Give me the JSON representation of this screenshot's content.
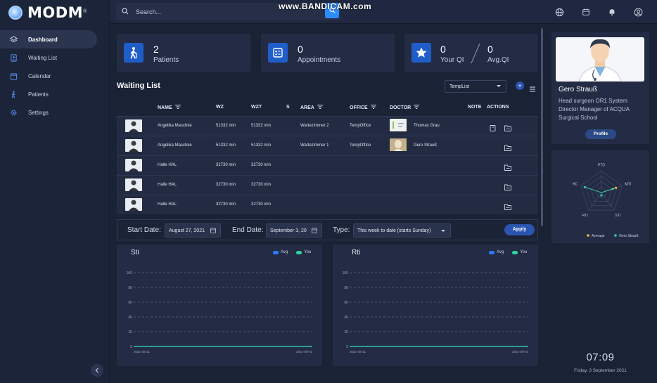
{
  "app": {
    "name": "MODM",
    "trademark": "®"
  },
  "watermark": "www.BANDICAM.com",
  "search": {
    "placeholder": "Search..."
  },
  "sidebar": {
    "items": [
      {
        "label": "Dashboard",
        "icon": "layers-icon"
      },
      {
        "label": "Waiting List",
        "icon": "waiting-list-icon"
      },
      {
        "label": "Calendar",
        "icon": "calendar-icon"
      },
      {
        "label": "Patients",
        "icon": "walking-person-icon"
      },
      {
        "label": "Settings",
        "icon": "gear-icon"
      }
    ]
  },
  "topbar_icons": [
    "globe-icon",
    "calendar-icon",
    "bell-icon",
    "user-circle-icon"
  ],
  "stats": {
    "patients": {
      "value": "2",
      "label": "Patients"
    },
    "appointments": {
      "value": "0",
      "label": "Appointments"
    },
    "qi": {
      "your_value": "0",
      "your_label": "Your QI",
      "separator": "/",
      "avg_value": "0",
      "avg_label": "Avg.QI"
    }
  },
  "waiting_list": {
    "title": "Waiting List",
    "template_select": "TempList",
    "add_label": "+",
    "columns": [
      "NAME",
      "WZ",
      "WZT",
      "S",
      "AREA",
      "OFFICE",
      "DOCTOR",
      "NOTE",
      "ACTIONS"
    ],
    "rows": [
      {
        "name": "Angelika Maschke",
        "wz": "51332 min",
        "wzt": "51332 min",
        "s": "",
        "area": "Wartezimmer 2",
        "office": "TempOffice",
        "doctor": "Thomas Grau",
        "note_icon": true
      },
      {
        "name": "Angelika Maschke",
        "wz": "51332 min",
        "wzt": "51332 min",
        "s": "",
        "area": "Wartezimmer 1",
        "office": "TempOffice",
        "doctor": "Gero Strauß",
        "note_icon": false
      },
      {
        "name": "Halle HAL",
        "wz": "32730 min",
        "wzt": "32730 min",
        "s": "",
        "area": "",
        "office": "",
        "doctor": "",
        "note_icon": false
      },
      {
        "name": "Halle HAL",
        "wz": "32730 min",
        "wzt": "32730 min",
        "s": "",
        "area": "",
        "office": "",
        "doctor": "",
        "note_icon": false
      },
      {
        "name": "Halle HAL",
        "wz": "32730 min",
        "wzt": "32730 min",
        "s": "",
        "area": "",
        "office": "",
        "doctor": "",
        "note_icon": false
      }
    ]
  },
  "filter": {
    "start_label": "Start Date:",
    "start_value": "August 27, 2021",
    "end_label": "End Date:",
    "end_value": "September 3, 20",
    "type_label": "Type:",
    "type_value": "This week to date (starts Sunday)",
    "apply_label": "Apply"
  },
  "chart_data": [
    {
      "type": "line",
      "title": "Sti",
      "x": [
        "2021-08-31",
        "2021-09-01"
      ],
      "series": [
        {
          "name": "Avg",
          "values": [
            0,
            0
          ],
          "color": "#2a7cff"
        },
        {
          "name": "You",
          "values": [
            0,
            0
          ],
          "color": "#2fd3a0"
        }
      ],
      "y_ticks": [
        0,
        20,
        40,
        60,
        80,
        100
      ],
      "ylim": [
        0,
        100
      ],
      "grid": true,
      "legend": "top-right"
    },
    {
      "type": "line",
      "title": "Rti",
      "x": [
        "2021-08-31",
        "2021-09-01"
      ],
      "series": [
        {
          "name": "Avg",
          "values": [
            0,
            0
          ],
          "color": "#2a7cff"
        },
        {
          "name": "You",
          "values": [
            0,
            0
          ],
          "color": "#2fd3a0"
        }
      ],
      "y_ticks": [
        0,
        20,
        40,
        60,
        80,
        100
      ],
      "ylim": [
        0,
        100
      ],
      "grid": true,
      "legend": "top-right"
    },
    {
      "type": "radar",
      "axes": [
        "PTD",
        "MTI",
        "STI",
        "RTI",
        "HC"
      ],
      "series": [
        {
          "name": "Average",
          "values": [
            0,
            0.7,
            0,
            0,
            0
          ],
          "color": "#ffb347"
        },
        {
          "name": "Gero Strauß",
          "values": [
            0,
            0.55,
            0,
            0,
            0.8
          ],
          "color": "#2fd3a0"
        }
      ],
      "legend": "bottom"
    }
  ],
  "profile": {
    "name": "Gero Strauß",
    "description": "Head surgeon OR1 System Director Manager of ACQUA Surgical School",
    "button_label": "Profile"
  },
  "clock": {
    "time": "07:09",
    "date": "Friday, 3 September 2021"
  },
  "colors": {
    "accent": "#2a8cff",
    "primary_button": "#2a55b0",
    "card": "#232c44",
    "background": "#1a2235"
  }
}
